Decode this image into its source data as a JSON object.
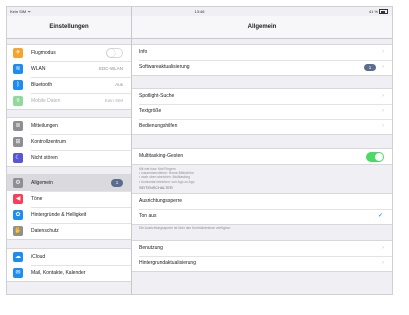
{
  "statusbar": {
    "carrier": "Kein SIM ᯤ",
    "time": "13:46",
    "battery": "41 %"
  },
  "sidebar": {
    "title": "Einstellungen",
    "group1": [
      {
        "label": "Flugmodus",
        "icon": "airplane-icon",
        "color": "#f7a42b",
        "glyph": "✈",
        "value": ""
      },
      {
        "label": "WLAN",
        "icon": "wifi-icon",
        "color": "#1b8ef5",
        "glyph": "≋",
        "value": "EDC-WLAN"
      },
      {
        "label": "Bluetooth",
        "icon": "bluetooth-icon",
        "color": "#1b8ef5",
        "glyph": "ᛒ",
        "value": "Aus"
      },
      {
        "label": "Mobile Daten",
        "icon": "antenna-icon",
        "color": "#8fd99a",
        "glyph": "⌽",
        "value": "Kein SIM"
      }
    ],
    "group2": [
      {
        "label": "Mitteilungen",
        "icon": "notifications-icon",
        "color": "#8e8e93",
        "glyph": "≣"
      },
      {
        "label": "Kontrollzentrum",
        "icon": "control-center-icon",
        "color": "#8e8e93",
        "glyph": "⊞"
      },
      {
        "label": "Nicht stören",
        "icon": "moon-icon",
        "color": "#5856d6",
        "glyph": "☾"
      }
    ],
    "group3": [
      {
        "label": "Allgemein",
        "icon": "gear-icon",
        "color": "#8e8e93",
        "glyph": "⚙",
        "badge": "1"
      },
      {
        "label": "Töne",
        "icon": "speaker-icon",
        "color": "#ff3b58",
        "glyph": "◀"
      },
      {
        "label": "Hintergründe & Helligkeit",
        "icon": "brightness-icon",
        "color": "#1b8ef5",
        "glyph": "✿"
      },
      {
        "label": "Datenschutz",
        "icon": "hand-icon",
        "color": "#8e8e93",
        "glyph": "✋"
      }
    ],
    "group4": [
      {
        "label": "iCloud",
        "icon": "cloud-icon",
        "color": "#1b8ef5",
        "glyph": "☁"
      },
      {
        "label": "Mail, Kontakte, Kalender",
        "icon": "mail-icon",
        "color": "#1b8ef5",
        "glyph": "✉"
      }
    ]
  },
  "main": {
    "title": "Allgemein",
    "group1": [
      {
        "label": "Info"
      },
      {
        "label": "Softwareaktualisierung",
        "badge": "1"
      }
    ],
    "group2": [
      {
        "label": "Spotlight-Suche"
      },
      {
        "label": "Textgröße"
      },
      {
        "label": "Bedienungshilfen"
      }
    ],
    "multitasking": {
      "label": "Multitasking-Gesten"
    },
    "multitasking_note": [
      "Mit vier bzw. fünf Fingern",
      "• zusammenziehen: Home-Bildschirm",
      "• nach oben streichen: Multitasking",
      "• horizontal streichen: von App zu App"
    ],
    "section_header": "SEITENSCHALTER",
    "switch_rows": [
      {
        "label": "Ausrichtungssperre",
        "checked": false
      },
      {
        "label": "Ton aus",
        "checked": true
      }
    ],
    "switch_note": "Die Ausrichtungssperre ist über das Kontrollzentrum verfügbar.",
    "group4": [
      {
        "label": "Benutzung"
      },
      {
        "label": "Hintergrundaktualisierung"
      }
    ]
  }
}
